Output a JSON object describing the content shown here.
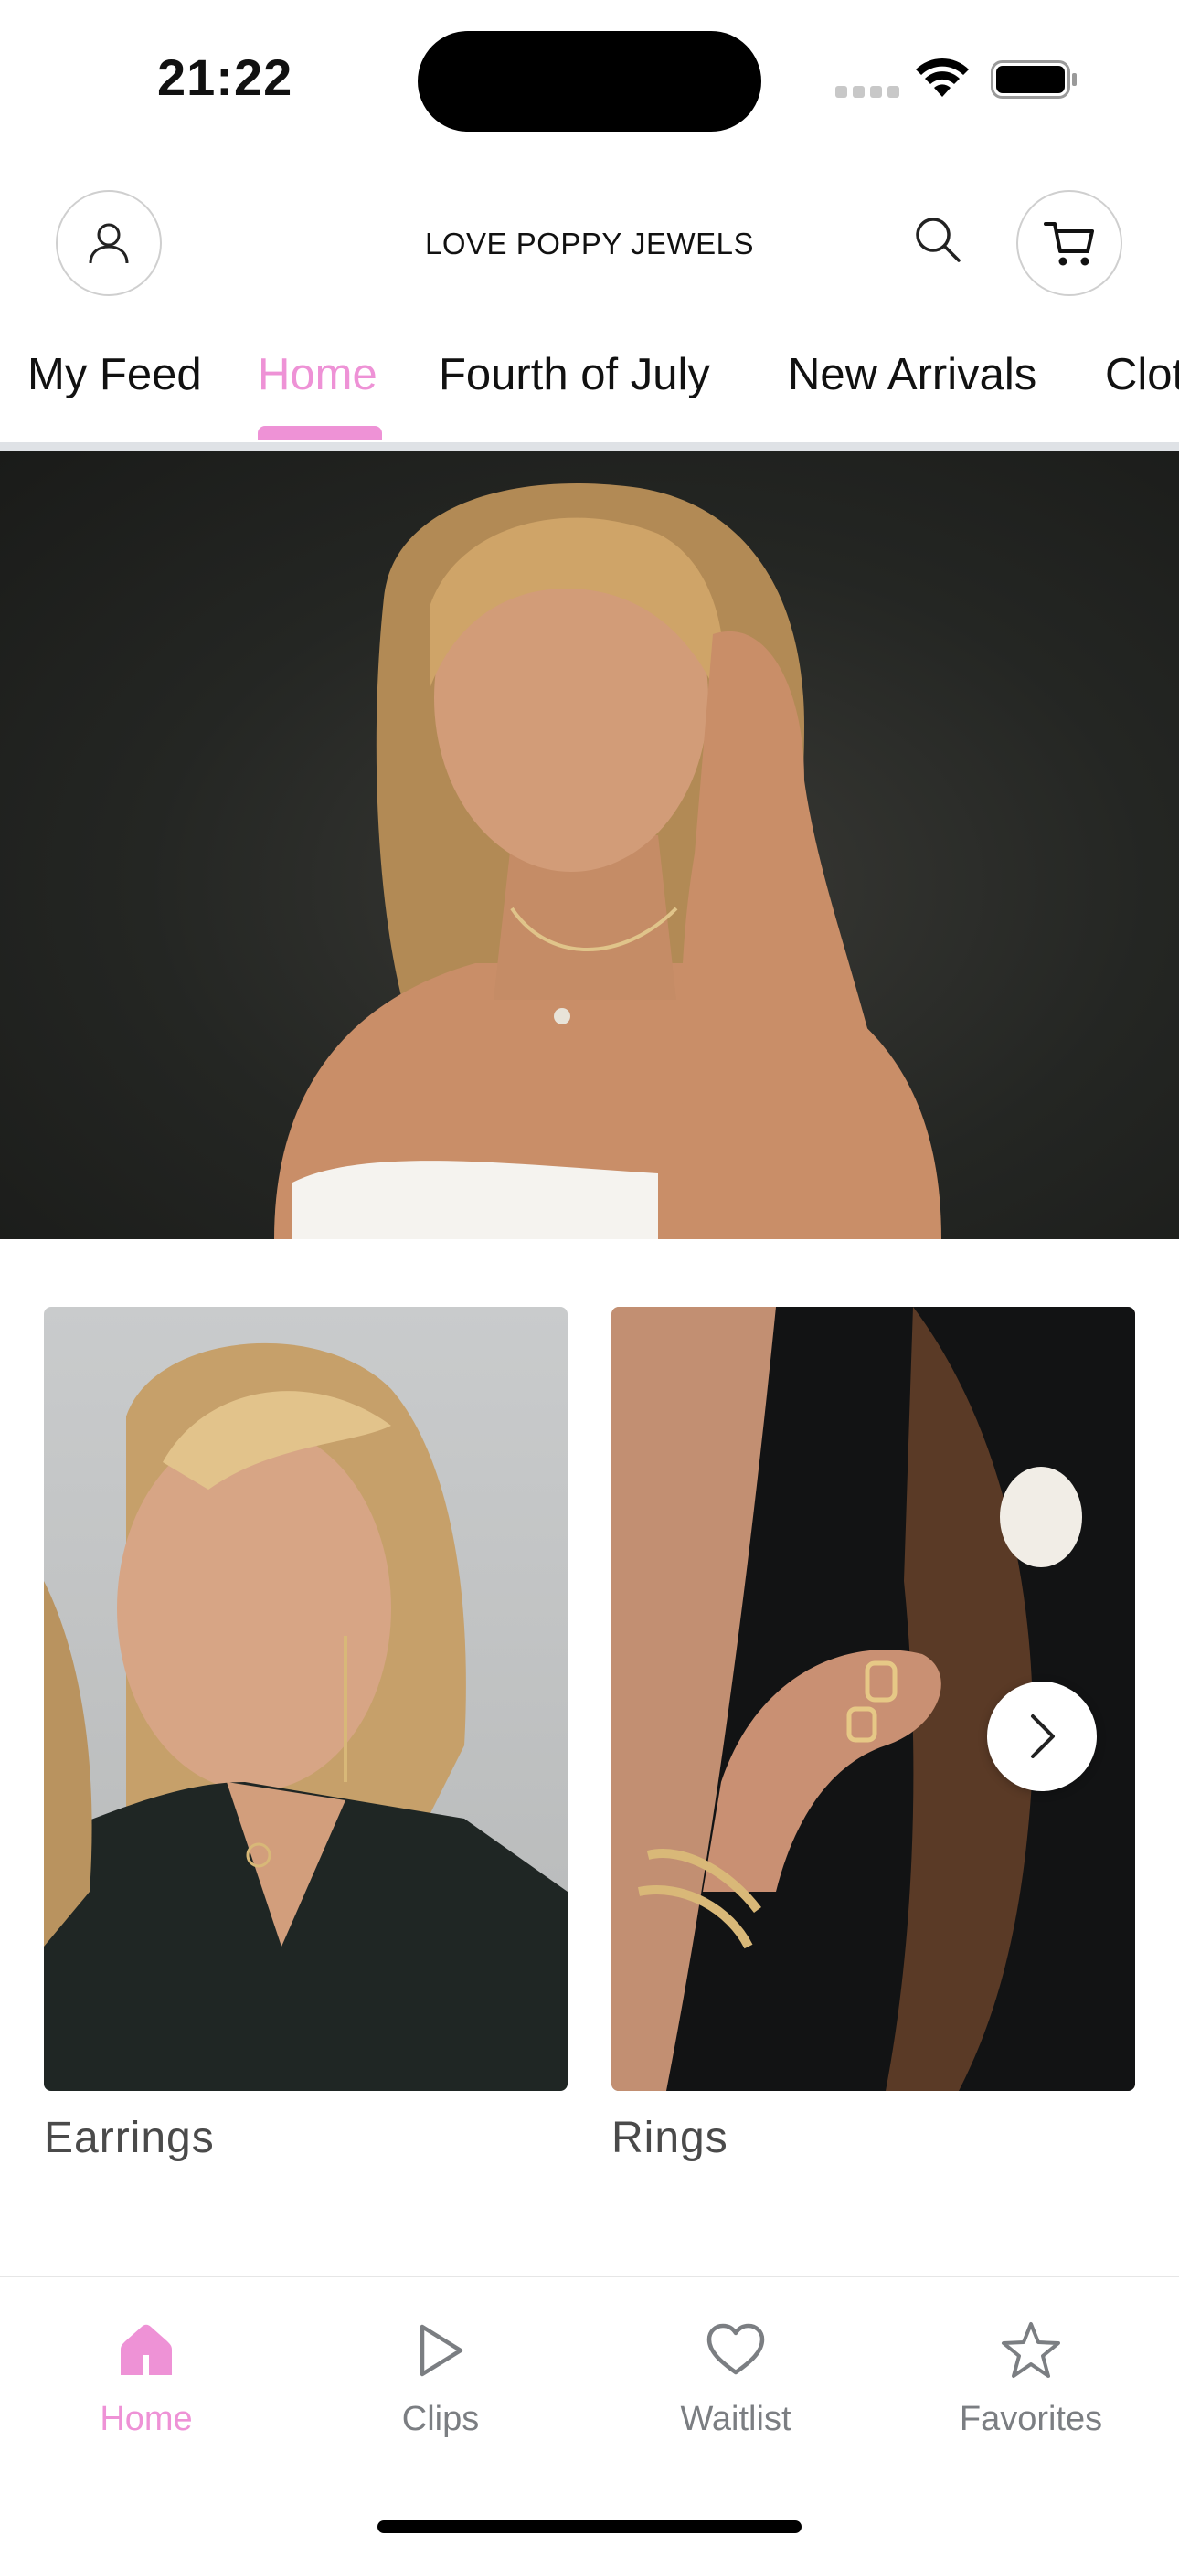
{
  "status": {
    "time": "21:22"
  },
  "header": {
    "brand": "LOVE POPPY JEWELS",
    "account_icon": "person-icon",
    "search_icon": "search-icon",
    "cart_icon": "cart-icon"
  },
  "tabs": [
    {
      "label": "My Feed",
      "active": false
    },
    {
      "label": "Home",
      "active": true
    },
    {
      "label": "Fourth of July",
      "active": false
    },
    {
      "label": "New Arrivals",
      "active": false
    },
    {
      "label": "Clot",
      "active": false
    }
  ],
  "categories": [
    {
      "label": "Earrings"
    },
    {
      "label": "Rings"
    }
  ],
  "bottom_nav": [
    {
      "label": "Home",
      "icon": "home-icon",
      "active": true
    },
    {
      "label": "Clips",
      "icon": "play-icon",
      "active": false
    },
    {
      "label": "Waitlist",
      "icon": "heart-icon",
      "active": false
    },
    {
      "label": "Favorites",
      "icon": "star-icon",
      "active": false
    }
  ],
  "colors": {
    "accent": "#ee92d6",
    "inactive": "#7b7e82"
  }
}
